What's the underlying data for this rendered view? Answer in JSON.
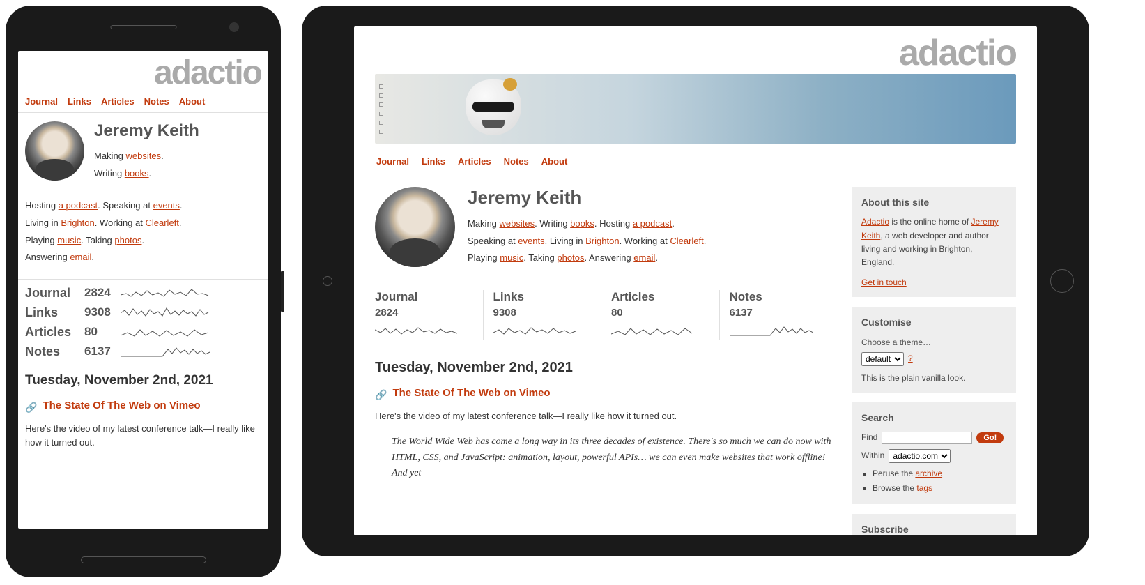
{
  "brand": "adactio",
  "nav": {
    "journal": "Journal",
    "links": "Links",
    "articles": "Articles",
    "notes": "Notes",
    "about": "About"
  },
  "author": "Jeremy Keith",
  "bio": {
    "making": "Making ",
    "websites": "websites",
    "dot1": ". ",
    "writing": "Writing ",
    "books": "books",
    "dot2": ". ",
    "hosting": "Hosting ",
    "podcast": "a podcast",
    "dot3": ". ",
    "speaking": "Speaking at ",
    "events": "events",
    "dot4": ". ",
    "living": "Living in ",
    "brighton": "Brighton",
    "dot5": ". ",
    "working": "Working at ",
    "clearleft": "Clearleft",
    "dot6": ". ",
    "playing": "Playing ",
    "music": "music",
    "dot7": ". ",
    "taking": "Taking ",
    "photos": "photos",
    "dot8": ". ",
    "answering": "Answering ",
    "email": "email",
    "dot9": "."
  },
  "stats": {
    "journal": {
      "label": "Journal",
      "count": "2824"
    },
    "links": {
      "label": "Links",
      "count": "9308"
    },
    "articles": {
      "label": "Articles",
      "count": "80"
    },
    "notes": {
      "label": "Notes",
      "count": "6137"
    }
  },
  "date": "Tuesday, November 2nd, 2021",
  "post": {
    "title": "The State Of The Web on Vimeo",
    "body_phone": "Here's the video of my latest conference talk—I really like how it turned out.",
    "body": "Here's the video of my latest conference talk—I really like how it turned out.",
    "quote": "The World Wide Web has come a long way in its three decades of existence. There's so much we can do now with HTML, CSS, and JavaScript: animation, layout, powerful APIs… we can even make websites that work offline! And yet"
  },
  "sidebar": {
    "about": {
      "heading": "About this site",
      "t1": " is the online home of ",
      "adactio": "Adactio",
      "jeremy": "Jeremy Keith",
      "t2": ", a web developer and author living and working in Brighton, England.",
      "contact": "Get in touch"
    },
    "customise": {
      "heading": "Customise",
      "label": "Choose a theme…",
      "selected": "default",
      "help": "?",
      "desc": "This is the plain vanilla look."
    },
    "search": {
      "heading": "Search",
      "find": "Find",
      "go": "Go!",
      "within": "Within",
      "scope": "adactio.com",
      "peruse": "Peruse the ",
      "archive": "archive",
      "browse": "Browse the ",
      "tags": "tags"
    },
    "subscribe": {
      "heading": "Subscribe"
    }
  }
}
